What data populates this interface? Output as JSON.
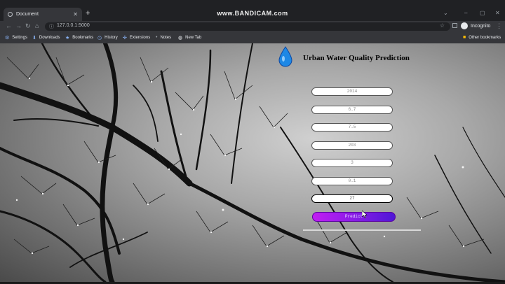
{
  "browser": {
    "tab_title": "Document",
    "tab_close": "✕",
    "new_tab": "+",
    "watermark": "www.BANDICAM.com",
    "window_controls": [
      "⌄",
      "–",
      "▢",
      "✕"
    ],
    "url": "127.0.0.1:5000",
    "profile_label": "Incognito",
    "bookmarks": [
      "Settings",
      "Downloads",
      "Bookmarks",
      "History",
      "Extensions",
      "Notes",
      "New Tab"
    ],
    "other_bookmarks": "Other bookmarks"
  },
  "page": {
    "heading": "Urban Water Quality Prediction",
    "fields": [
      {
        "value": "2014"
      },
      {
        "value": "6.7"
      },
      {
        "value": "7.5"
      },
      {
        "value": "203"
      },
      {
        "value": "3"
      },
      {
        "value": "0.1"
      },
      {
        "value": "27"
      }
    ],
    "predict_label": "Predict",
    "colors": {
      "predict_start": "#c21df2",
      "predict_end": "#4e17d6",
      "logo_drop": "#1e88e5"
    }
  }
}
